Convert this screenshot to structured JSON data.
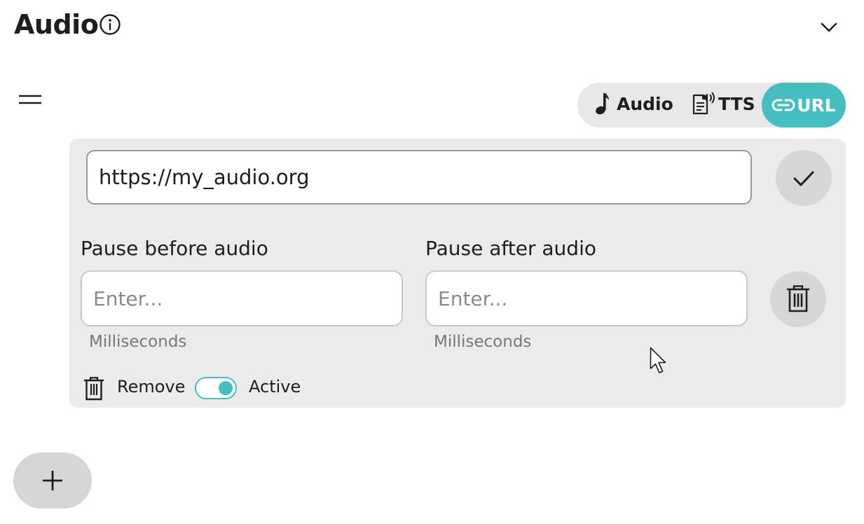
{
  "header": {
    "title": "Audio",
    "info_icon": "info-circle-icon",
    "collapse_icon": "chevron-down-icon"
  },
  "source_switch": {
    "options": [
      {
        "label": "Audio",
        "icon": "music-note-icon"
      },
      {
        "label": "TTS",
        "icon": "text-to-speech-icon"
      },
      {
        "label": "URL",
        "icon": "link-icon"
      }
    ],
    "selected": "URL"
  },
  "url_field": {
    "value": "https://my_audio.org"
  },
  "pause_before": {
    "label": "Pause before audio",
    "placeholder": "Enter...",
    "hint": "Milliseconds"
  },
  "pause_after": {
    "label": "Pause after audio",
    "placeholder": "Enter...",
    "hint": "Milliseconds"
  },
  "footer": {
    "remove_label": "Remove",
    "active_label": "Active",
    "active": true
  },
  "colors": {
    "accent": "#45bec2",
    "panel_bg": "#ebebeb",
    "button_bg": "#d6d6d6"
  }
}
